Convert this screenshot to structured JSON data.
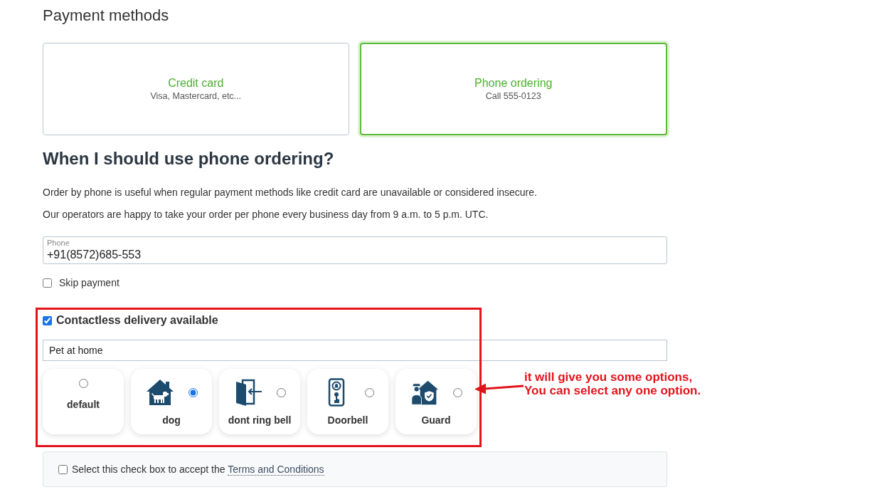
{
  "payment_methods": {
    "title": "Payment methods",
    "options": [
      {
        "title": "Credit card",
        "subtitle": "Visa, Mastercard, etc...",
        "selected": false
      },
      {
        "title": "Phone ordering",
        "subtitle": "Call 555-0123",
        "selected": true
      }
    ]
  },
  "info": {
    "heading": "When I should use phone ordering?",
    "paragraphs": [
      "Order by phone is useful when regular payment methods like credit card are unavailable or considered insecure.",
      "Our operators are happy to take your order per phone every business day from 9 a.m. to 5 p.m. UTC."
    ]
  },
  "phone_field": {
    "label": "Phone",
    "value": "+91(8572)685-553"
  },
  "skip_payment": {
    "label": "Skip payment",
    "checked": false
  },
  "contactless": {
    "label": "Contactless delivery available",
    "checked": true,
    "note_field": {
      "value": "Pet at home"
    },
    "options": [
      {
        "kind": "plain",
        "label": "default",
        "selected": false
      },
      {
        "kind": "dog",
        "label": "dog",
        "selected": true
      },
      {
        "kind": "door",
        "label": "dont ring bell",
        "selected": false
      },
      {
        "kind": "doorbell",
        "label": "Doorbell",
        "selected": false
      },
      {
        "kind": "guard",
        "label": "Guard",
        "selected": false
      }
    ]
  },
  "annotation": {
    "lines": [
      "it will give you some options,",
      "You can select any one option."
    ]
  },
  "terms": {
    "text": "Select this check box to accept the",
    "link": "Terms and Conditions",
    "checked": false
  }
}
